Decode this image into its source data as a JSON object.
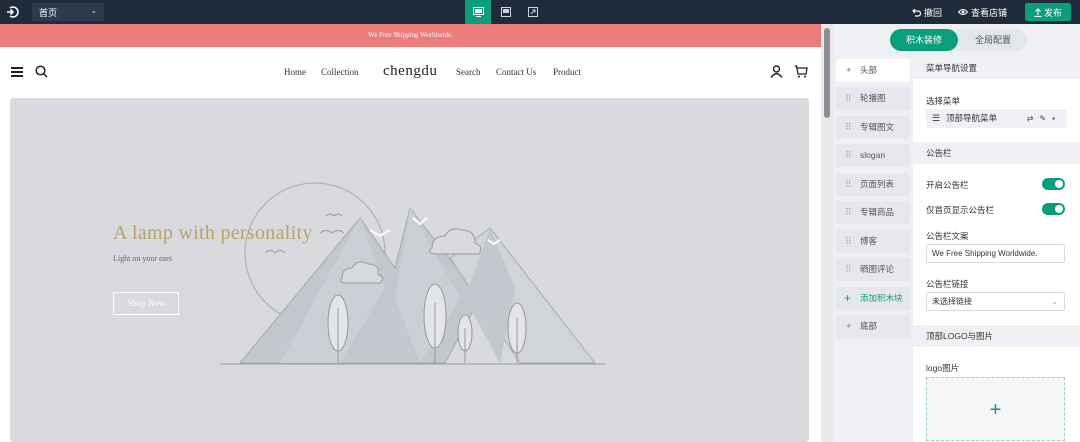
{
  "topbar": {
    "page_select": "首页",
    "undo_label": "撤回",
    "view_store_label": "查看店铺",
    "publish_label": "发布"
  },
  "preview": {
    "announcement": "We Free Shipping Worldwide.",
    "brand": "chengdu",
    "nav_left": [
      "Home",
      "Collection"
    ],
    "nav_right": [
      "Search",
      "Contact Us",
      "Product"
    ],
    "hero": {
      "title": "A lamp with personality",
      "subtitle": "Light on your ears",
      "button": "Shop Now"
    }
  },
  "panel": {
    "tabs": [
      "积木装修",
      "全局配置"
    ],
    "blocks": [
      "头部",
      "轮播图",
      "专辑图文",
      "slogan",
      "页面列表",
      "专辑商品",
      "博客",
      "晒图评论",
      "添加积木块",
      "底部"
    ],
    "settings": {
      "menu_section": "菜单导航设置",
      "select_menu_label": "选择菜单",
      "menu_value": "顶部导航菜单",
      "announce_section": "公告栏",
      "enable_announce": "开启公告栏",
      "home_only": "仅首页显示公告栏",
      "announce_text_label": "公告栏文案",
      "announce_text_value": "We Free Shipping Worldwide.",
      "announce_link_label": "公告栏链接",
      "announce_link_value": "未选择链接",
      "logo_section": "顶部LOGO与图片",
      "logo_image_label": "logo图片",
      "upload_plus": "+"
    }
  },
  "colors": {
    "accent": "#0b9e7d",
    "announce_bg": "#ec7b7b",
    "hero_title": "#b8a46a",
    "topbar": "#1f2a3a"
  }
}
